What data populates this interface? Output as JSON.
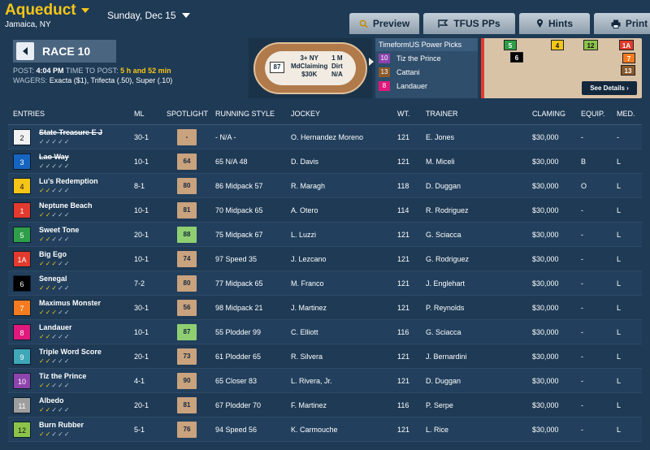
{
  "header": {
    "track": "Aqueduct",
    "location": "Jamaica, NY",
    "date": "Sunday, Dec 15"
  },
  "tabs": [
    {
      "label": "Preview",
      "icon": "search-icon"
    },
    {
      "label": "TFUS PPs",
      "icon": "flag-icon"
    },
    {
      "label": "Hints",
      "icon": "pin-icon"
    },
    {
      "label": "Print",
      "icon": "printer-icon"
    }
  ],
  "race": {
    "name": "RACE 10",
    "post_label": "POST:",
    "post_time": "4:04 PM",
    "ttp_label": "TIME TO POST:",
    "ttp_value": "5 h and 52 min",
    "wagers_label": "WAGERS:",
    "wagers": "Exacta ($1), Trifecta (.50), Super (.10)"
  },
  "oval": {
    "number": "87",
    "line1": "3+ NY",
    "line2": "MdClaiming",
    "line3": "$30K",
    "dist1": "1 M",
    "dist2": "Dirt",
    "dist3": "N/A"
  },
  "power_picks": {
    "title": "TimeformUS Power Picks",
    "picks": [
      {
        "num": "10",
        "name": "Tiz the Prince",
        "color": "#8e44ad"
      },
      {
        "num": "13",
        "name": "Cattani",
        "color": "#8b5a2b"
      },
      {
        "num": "8",
        "name": "Landauer",
        "color": "#e0197d"
      }
    ]
  },
  "minimap": {
    "horses": [
      "5",
      "4",
      "12",
      "1A",
      "6",
      "7",
      "13"
    ],
    "see_details": "See Details ›"
  },
  "columns": [
    "ENTRIES",
    "ML",
    "SPOTLIGHT",
    "RUNNING STYLE",
    "JOCKEY",
    "WT.",
    "TRAINER",
    "CLAMING",
    "EQUIP.",
    "MED."
  ],
  "entries": [
    {
      "num": "2",
      "name": "State Treasure E J",
      "scratched": true,
      "ml": "30-1",
      "spot": "-",
      "style": "- N/A -",
      "jockey": "O. Hernandez Moreno",
      "wt": "121",
      "trainer": "E. Jones",
      "claim": "$30,000",
      "equip": "-",
      "med": "-",
      "yellow": 0,
      "bg": "#f2f2f2",
      "fg": "#111",
      "spotbg": "#c9a27e"
    },
    {
      "num": "3",
      "name": "Lao Way",
      "scratched": true,
      "ml": "10-1",
      "spot": "64",
      "style": "65 N/A 48",
      "jockey": "D. Davis",
      "wt": "121",
      "trainer": "M. Miceli",
      "claim": "$30,000",
      "equip": "B",
      "med": "L",
      "yellow": 0,
      "bg": "#1565c0",
      "fg": "#fff",
      "spotbg": "#c9a27e"
    },
    {
      "num": "4",
      "name": "Lu's Redemption",
      "scratched": false,
      "ml": "8-1",
      "spot": "80",
      "style": "86 Midpack 57",
      "jockey": "R. Maragh",
      "wt": "118",
      "trainer": "D. Duggan",
      "claim": "$30,000",
      "equip": "O",
      "med": "L",
      "yellow": 2,
      "bg": "#f5c518",
      "fg": "#111",
      "spotbg": "#c9a27e"
    },
    {
      "num": "1",
      "name": "Neptune Beach",
      "scratched": false,
      "ml": "10-1",
      "spot": "81",
      "style": "70 Midpack 65",
      "jockey": "A. Otero",
      "wt": "114",
      "trainer": "R. Rodriguez",
      "claim": "$30,000",
      "equip": "-",
      "med": "L",
      "yellow": 2,
      "bg": "#e23a2e",
      "fg": "#fff",
      "spotbg": "#c9a27e"
    },
    {
      "num": "5",
      "name": "Sweet Tone",
      "scratched": false,
      "ml": "20-1",
      "spot": "88",
      "style": "75 Midpack 67",
      "jockey": "L. Luzzi",
      "wt": "121",
      "trainer": "G. Sciacca",
      "claim": "$30,000",
      "equip": "-",
      "med": "L",
      "yellow": 2,
      "bg": "#2e9e48",
      "fg": "#fff",
      "spotbg": "#8fcf72"
    },
    {
      "num": "1A",
      "name": "Big Ego",
      "scratched": false,
      "ml": "10-1",
      "spot": "74",
      "style": "97 Speed 35",
      "jockey": "J. Lezcano",
      "wt": "121",
      "trainer": "G. Rodriguez",
      "claim": "$30,000",
      "equip": "-",
      "med": "L",
      "yellow": 3,
      "bg": "#e23a2e",
      "fg": "#fff",
      "spotbg": "#c9a27e"
    },
    {
      "num": "6",
      "name": "Senegal",
      "scratched": false,
      "ml": "7-2",
      "spot": "80",
      "style": "77 Midpack 65",
      "jockey": "M. Franco",
      "wt": "121",
      "trainer": "J. Englehart",
      "claim": "$30,000",
      "equip": "-",
      "med": "L",
      "yellow": 3,
      "bg": "#000000",
      "fg": "#fff",
      "spotbg": "#c9a27e"
    },
    {
      "num": "7",
      "name": "Maximus Monster",
      "scratched": false,
      "ml": "30-1",
      "spot": "56",
      "style": "98 Midpack 21",
      "jockey": "J. Martinez",
      "wt": "121",
      "trainer": "P. Reynolds",
      "claim": "$30,000",
      "equip": "-",
      "med": "L",
      "yellow": 3,
      "bg": "#f47b20",
      "fg": "#fff",
      "spotbg": "#c9a27e"
    },
    {
      "num": "8",
      "name": "Landauer",
      "scratched": false,
      "ml": "10-1",
      "spot": "87",
      "style": "55 Plodder 99",
      "jockey": "C. Elliott",
      "wt": "116",
      "trainer": "G. Sciacca",
      "claim": "$30,000",
      "equip": "-",
      "med": "L",
      "yellow": 2,
      "bg": "#e0197d",
      "fg": "#fff",
      "spotbg": "#8fcf72"
    },
    {
      "num": "9",
      "name": "Triple Word Score",
      "scratched": false,
      "ml": "20-1",
      "spot": "73",
      "style": "61 Plodder 65",
      "jockey": "R. Silvera",
      "wt": "121",
      "trainer": "J. Bernardini",
      "claim": "$30,000",
      "equip": "-",
      "med": "L",
      "yellow": 2,
      "bg": "#3fa7b8",
      "fg": "#fff",
      "spotbg": "#c9a27e"
    },
    {
      "num": "10",
      "name": "Tiz the Prince",
      "scratched": false,
      "ml": "4-1",
      "spot": "90",
      "style": "65 Closer 83",
      "jockey": "L. Rivera, Jr.",
      "wt": "121",
      "trainer": "D. Duggan",
      "claim": "$30,000",
      "equip": "-",
      "med": "L",
      "yellow": 2,
      "bg": "#8e44ad",
      "fg": "#fff",
      "spotbg": "#c9a27e"
    },
    {
      "num": "11",
      "name": "Albedo",
      "scratched": false,
      "ml": "20-1",
      "spot": "81",
      "style": "67 Plodder 70",
      "jockey": "F. Martinez",
      "wt": "116",
      "trainer": "P. Serpe",
      "claim": "$30,000",
      "equip": "-",
      "med": "L",
      "yellow": 2,
      "bg": "#9e9e9e",
      "fg": "#fff",
      "spotbg": "#c9a27e"
    },
    {
      "num": "12",
      "name": "Burn Rubber",
      "scratched": false,
      "ml": "5-1",
      "spot": "76",
      "style": "94 Speed 56",
      "jockey": "K. Carmouche",
      "wt": "121",
      "trainer": "L. Rice",
      "claim": "$30,000",
      "equip": "-",
      "med": "L",
      "yellow": 2,
      "bg": "#8bc34a",
      "fg": "#111",
      "spotbg": "#c9a27e"
    }
  ]
}
